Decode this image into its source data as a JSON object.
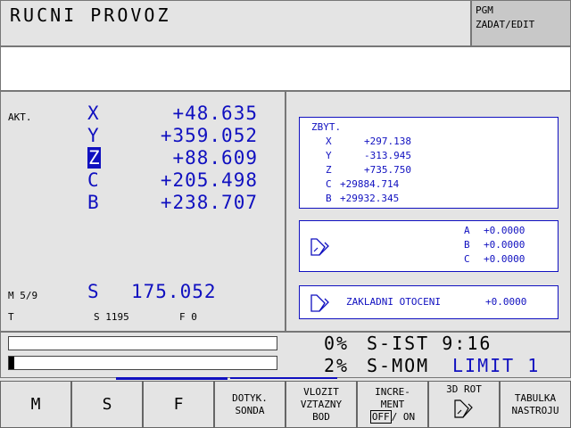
{
  "header": {
    "title": "RUCNI PROVOZ",
    "mode_line1": "PGM",
    "mode_line2": "ZADAT/EDIT"
  },
  "position": {
    "label": "AKT.",
    "axes": [
      {
        "axis": "X",
        "value": "+48.635"
      },
      {
        "axis": "Y",
        "value": "+359.052"
      },
      {
        "axis": "Z",
        "value": "+88.609"
      },
      {
        "axis": "C",
        "value": "+205.498"
      },
      {
        "axis": "B",
        "value": "+238.707"
      }
    ],
    "m_label": "M 5/9",
    "s_label": "S",
    "s_value": "175.052",
    "t_label": "T",
    "s_speed": "S 1195",
    "feed": "F 0"
  },
  "zbyt": {
    "title": "ZBYT.",
    "rows": [
      {
        "axis": "X",
        "value": "+297.138"
      },
      {
        "axis": "Y",
        "value": "-313.945"
      },
      {
        "axis": "Z",
        "value": "+735.750"
      },
      {
        "axis": "C",
        "value": "+29884.714"
      },
      {
        "axis": "B",
        "value": "+29932.345"
      }
    ]
  },
  "rotation": {
    "rows": [
      {
        "axis": "A",
        "value": "+0.0000"
      },
      {
        "axis": "B",
        "value": "+0.0000"
      },
      {
        "axis": "C",
        "value": "+0.0000"
      }
    ],
    "basic_label": "ZAKLADNI OTOCENI",
    "basic_value": "+0.0000"
  },
  "status": {
    "line1_pct": "0%",
    "line1_text": "S-IST 9:16",
    "line2_pct": "2%",
    "line2_text": "S-MOM",
    "limit_text": "LIMIT 1",
    "bar1_fill": 0.0,
    "bar2_fill": 0.02
  },
  "softkeys": {
    "m": "M",
    "s": "S",
    "f": "F",
    "probe_1": "DOTYK.",
    "probe_2": "SONDA",
    "datum_1": "VLOZIT",
    "datum_2": "VZTAZNY",
    "datum_3": "BOD",
    "incr_1": "INCRE-",
    "incr_2": "MENT",
    "incr_off": "OFF",
    "incr_on": "/ ON",
    "rot_label": "3D ROT",
    "tool_1": "TABULKA",
    "tool_2": "NASTROJU"
  },
  "colors": {
    "accent": "#1010c0",
    "background": "#e4e4e4",
    "panel_white": "#ffffff"
  }
}
